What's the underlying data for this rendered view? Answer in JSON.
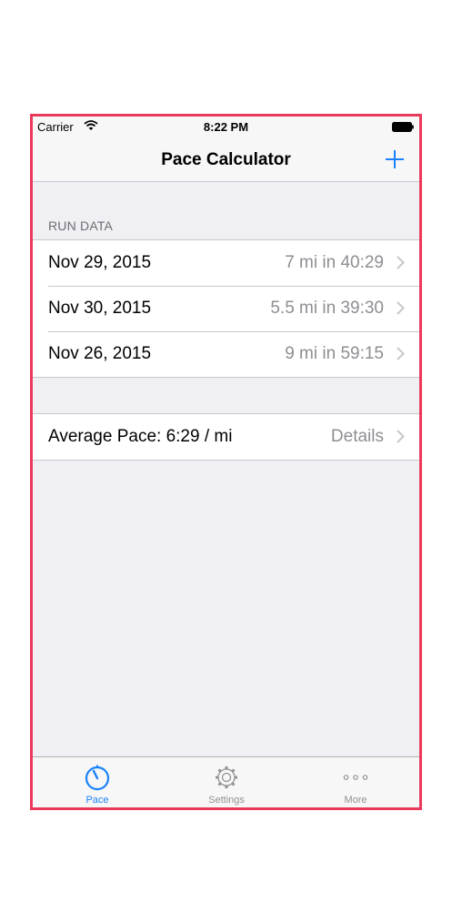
{
  "status_bar": {
    "carrier": "Carrier",
    "time": "8:22 PM"
  },
  "nav": {
    "title": "Pace Calculator",
    "add_icon": "plus-icon"
  },
  "run_section": {
    "header": "RUN DATA",
    "rows": [
      {
        "date": "Nov 29, 2015",
        "summary": "7 mi in 40:29"
      },
      {
        "date": "Nov 30, 2015",
        "summary": "5.5 mi in 39:30"
      },
      {
        "date": "Nov 26, 2015",
        "summary": "9 mi in 59:15"
      }
    ]
  },
  "average": {
    "label": "Average Pace: 6:29 / mi",
    "action": "Details"
  },
  "tabs": [
    {
      "label": "Pace",
      "icon": "stopwatch-icon",
      "active": true
    },
    {
      "label": "Settings",
      "icon": "gear-icon",
      "active": false
    },
    {
      "label": "More",
      "icon": "more-dots-icon",
      "active": false
    }
  ],
  "colors": {
    "accent": "#1a82fb",
    "frame_border": "#ea3a5c",
    "background": "#efeff4"
  }
}
